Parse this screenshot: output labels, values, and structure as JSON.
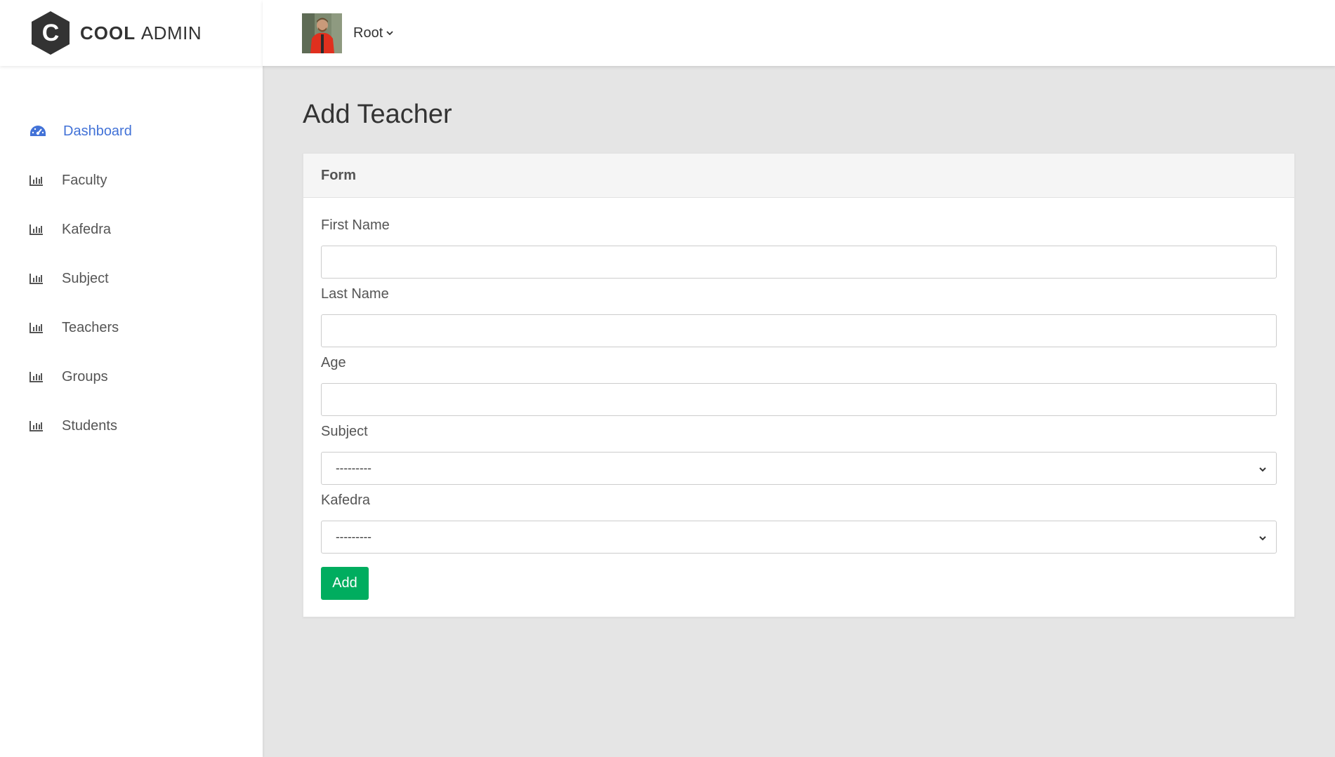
{
  "brand": {
    "logo_letter": "C",
    "name_bold": "COOL",
    "name_light": "ADMIN"
  },
  "colors": {
    "accent": "#4272d7",
    "button": "#00ad5f",
    "logo": "#333333"
  },
  "header": {
    "user_name": "Root"
  },
  "sidebar": {
    "items": [
      {
        "label": "Dashboard",
        "icon": "tachometer-icon",
        "active": true
      },
      {
        "label": "Faculty",
        "icon": "bar-chart-icon"
      },
      {
        "label": "Kafedra",
        "icon": "bar-chart-icon"
      },
      {
        "label": "Subject",
        "icon": "bar-chart-icon"
      },
      {
        "label": "Teachers",
        "icon": "bar-chart-icon"
      },
      {
        "label": "Groups",
        "icon": "bar-chart-icon"
      },
      {
        "label": "Students",
        "icon": "bar-chart-icon"
      }
    ]
  },
  "main": {
    "title": "Add Teacher",
    "card_title": "Form",
    "fields": {
      "first_name": {
        "label": "First Name",
        "value": ""
      },
      "last_name": {
        "label": "Last Name",
        "value": ""
      },
      "age": {
        "label": "Age",
        "value": ""
      },
      "subject": {
        "label": "Subject",
        "selected": "---------"
      },
      "kafedra": {
        "label": "Kafedra",
        "selected": "---------"
      }
    },
    "submit_label": "Add"
  }
}
